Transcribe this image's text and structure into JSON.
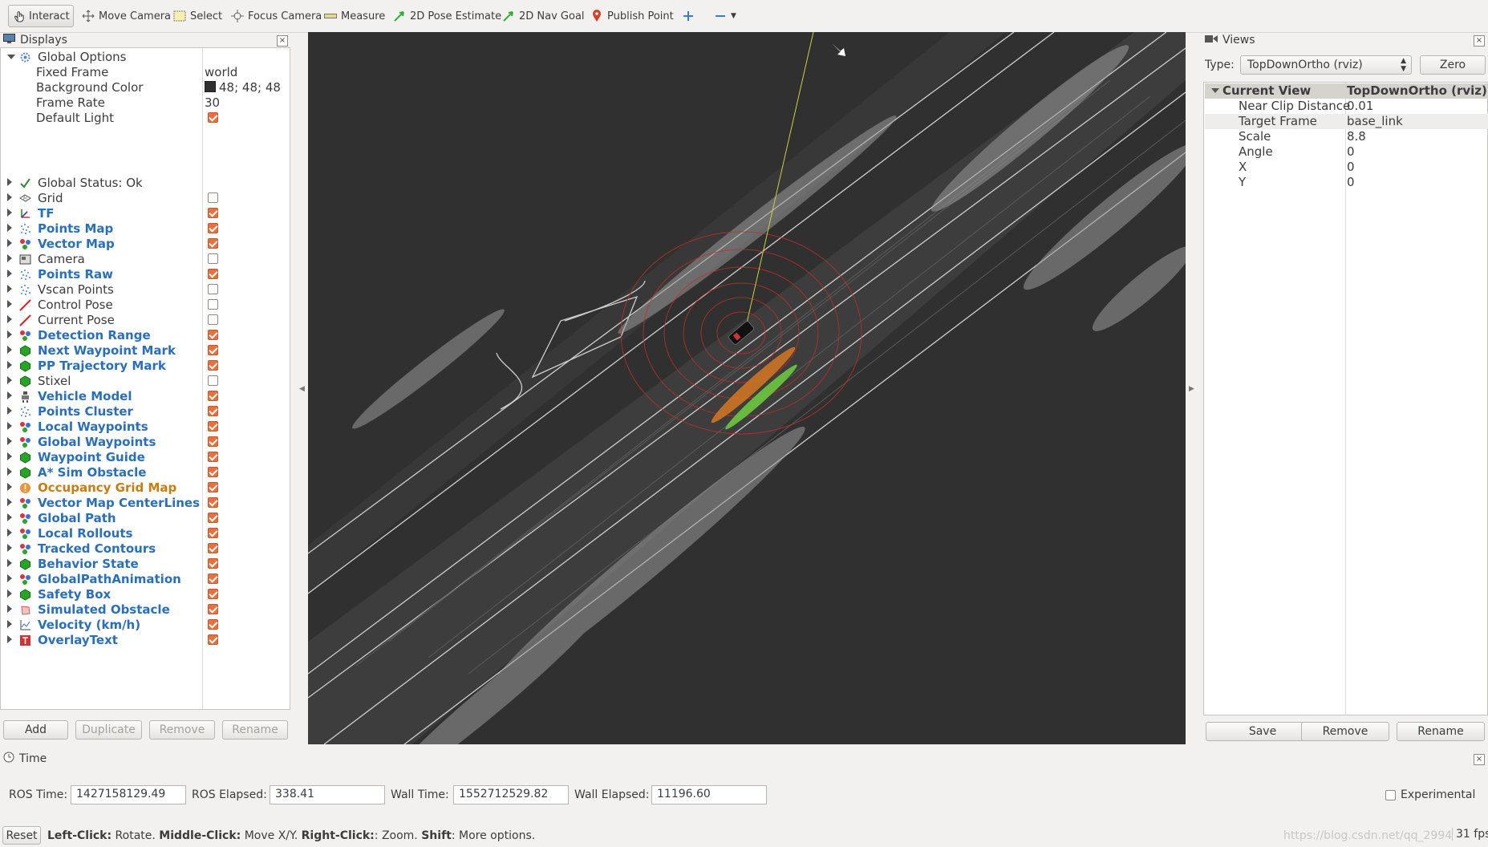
{
  "toolbar": {
    "items": [
      "Interact",
      "Move Camera",
      "Select",
      "Focus Camera",
      "Measure",
      "2D Pose Estimate",
      "2D Nav Goal",
      "Publish Point"
    ]
  },
  "displays": {
    "title": "Displays",
    "global_options": "Global Options",
    "options": [
      {
        "key": "Fixed Frame",
        "value": "world"
      },
      {
        "key": "Background Color",
        "value": "48; 48; 48",
        "swatch": "#303030"
      },
      {
        "key": "Frame Rate",
        "value": "30"
      },
      {
        "key": "Default Light",
        "value": "",
        "checked": true
      }
    ],
    "status": "Global Status: Ok",
    "items": [
      {
        "label": "Grid",
        "icon": "grid-icon",
        "style": "plain",
        "checked": false
      },
      {
        "label": "TF",
        "icon": "tf-icon",
        "style": "blue",
        "checked": true
      },
      {
        "label": "Points Map",
        "icon": "pointcloud-icon",
        "style": "blue",
        "checked": true
      },
      {
        "label": "Vector Map",
        "icon": "marker-array-icon",
        "style": "blue",
        "checked": true
      },
      {
        "label": "Camera",
        "icon": "camera-icon",
        "style": "plain",
        "checked": false
      },
      {
        "label": "Points Raw",
        "icon": "pointcloud-icon",
        "style": "blue",
        "checked": true
      },
      {
        "label": "Vscan Points",
        "icon": "pointcloud-icon",
        "style": "plain",
        "checked": false
      },
      {
        "label": "Control Pose",
        "icon": "pose-icon",
        "style": "plain",
        "checked": false
      },
      {
        "label": "Current Pose",
        "icon": "pose-icon",
        "style": "plain",
        "checked": false
      },
      {
        "label": "Detection Range",
        "icon": "marker-array-icon",
        "style": "blue",
        "checked": true
      },
      {
        "label": "Next Waypoint Mark",
        "icon": "marker-icon",
        "style": "blue",
        "checked": true
      },
      {
        "label": "PP Trajectory Mark",
        "icon": "marker-icon",
        "style": "blue",
        "checked": true
      },
      {
        "label": "Stixel",
        "icon": "marker-icon",
        "style": "plain",
        "checked": false
      },
      {
        "label": "Vehicle Model",
        "icon": "robot-model-icon",
        "style": "blue",
        "checked": true
      },
      {
        "label": "Points Cluster",
        "icon": "pointcloud-icon",
        "style": "blue",
        "checked": true
      },
      {
        "label": "Local Waypoints",
        "icon": "marker-array-icon",
        "style": "blue",
        "checked": true
      },
      {
        "label": "Global Waypoints",
        "icon": "marker-array-icon",
        "style": "blue",
        "checked": true
      },
      {
        "label": "Waypoint Guide",
        "icon": "marker-icon",
        "style": "blue",
        "checked": true
      },
      {
        "label": "A* Sim Obstacle",
        "icon": "marker-icon",
        "style": "blue",
        "checked": true
      },
      {
        "label": "Occupancy Grid Map",
        "icon": "map-warning-icon",
        "style": "orange",
        "checked": true
      },
      {
        "label": "Vector Map CenterLines",
        "icon": "marker-array-icon",
        "style": "blue",
        "checked": true
      },
      {
        "label": "Global Path",
        "icon": "marker-array-icon",
        "style": "blue",
        "checked": true
      },
      {
        "label": "Local Rollouts",
        "icon": "marker-array-icon",
        "style": "blue",
        "checked": true
      },
      {
        "label": "Tracked Contours",
        "icon": "marker-array-icon",
        "style": "blue",
        "checked": true
      },
      {
        "label": "Behavior State",
        "icon": "marker-icon",
        "style": "blue",
        "checked": true
      },
      {
        "label": "GlobalPathAnimation",
        "icon": "marker-array-icon",
        "style": "blue",
        "checked": true
      },
      {
        "label": "Safety Box",
        "icon": "marker-icon",
        "style": "blue",
        "checked": true
      },
      {
        "label": "Simulated Obstacle",
        "icon": "polygon-icon",
        "style": "blue",
        "checked": true
      },
      {
        "label": "Velocity (km/h)",
        "icon": "plot-icon",
        "style": "blue",
        "checked": true
      },
      {
        "label": "OverlayText",
        "icon": "overlay-text-icon",
        "style": "blue",
        "checked": true
      }
    ],
    "buttons": {
      "add": "Add",
      "duplicate": "Duplicate",
      "remove": "Remove",
      "rename": "Rename"
    }
  },
  "views": {
    "title": "Views",
    "type_label": "Type:",
    "type_value": "TopDownOrtho (rviz)",
    "zero": "Zero",
    "current_view": {
      "key": "Current View",
      "value": "TopDownOrtho (rviz)"
    },
    "props": [
      {
        "key": "Near Clip Distance",
        "value": "0.01"
      },
      {
        "key": "Target Frame",
        "value": "base_link"
      },
      {
        "key": "Scale",
        "value": "8.8"
      },
      {
        "key": "Angle",
        "value": "0"
      },
      {
        "key": "X",
        "value": "0"
      },
      {
        "key": "Y",
        "value": "0"
      }
    ],
    "buttons": {
      "save": "Save",
      "remove": "Remove",
      "rename": "Rename"
    }
  },
  "time": {
    "title": "Time",
    "ros_time_label": "ROS Time:",
    "ros_time": "1427158129.49",
    "ros_elapsed_label": "ROS Elapsed:",
    "ros_elapsed": "338.41",
    "wall_time_label": "Wall Time:",
    "wall_time": "1552712529.82",
    "wall_elapsed_label": "Wall Elapsed:",
    "wall_elapsed": "11196.60",
    "experimental": "Experimental"
  },
  "statusbar": {
    "reset": "Reset",
    "left_click": "Left-Click:",
    "left_click_desc": " Rotate. ",
    "middle_click": "Middle-Click:",
    "middle_click_desc": " Move X/Y. ",
    "right_click": "Right-Click:",
    "right_click_desc": ": Zoom. ",
    "shift": "Shift",
    "shift_desc": ": More options.",
    "watermark": "https://blog.csdn.net/qq_2994",
    "fps": "31 fps"
  },
  "colors": {
    "viewport_bg": "#303030",
    "accent_check": "#e9703e",
    "link_blue": "#2a6fba",
    "warn_orange": "#c97c10"
  }
}
